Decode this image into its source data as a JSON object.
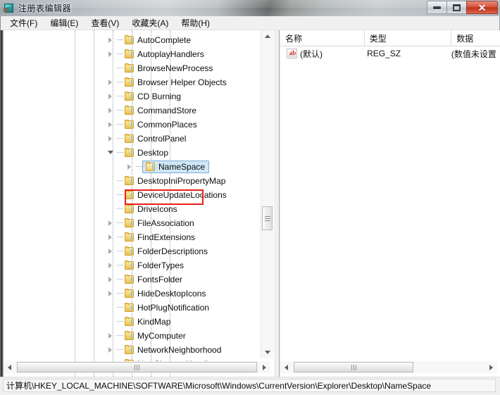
{
  "window": {
    "title": "注册表编辑器",
    "icon": "regedit-icon",
    "buttons": {
      "minimize": "–",
      "maximize": "□",
      "close": "✕"
    }
  },
  "menu": [
    {
      "label": "文件(F)",
      "name": "menu-file"
    },
    {
      "label": "编辑(E)",
      "name": "menu-edit"
    },
    {
      "label": "查看(V)",
      "name": "menu-view"
    },
    {
      "label": "收藏夹(A)",
      "name": "menu-favorites"
    },
    {
      "label": "帮助(H)",
      "name": "menu-help"
    }
  ],
  "tree": {
    "rows": [
      {
        "label": "AutoComplete",
        "twisty": "collapsed",
        "selected": false
      },
      {
        "label": "AutoplayHandlers",
        "twisty": "collapsed",
        "selected": false
      },
      {
        "label": "BrowseNewProcess",
        "twisty": "none",
        "selected": false
      },
      {
        "label": "Browser Helper Objects",
        "twisty": "collapsed",
        "selected": false
      },
      {
        "label": "CD Burning",
        "twisty": "collapsed",
        "selected": false
      },
      {
        "label": "CommandStore",
        "twisty": "collapsed",
        "selected": false
      },
      {
        "label": "CommonPlaces",
        "twisty": "collapsed",
        "selected": false
      },
      {
        "label": "ControlPanel",
        "twisty": "collapsed",
        "selected": false
      },
      {
        "label": "Desktop",
        "twisty": "expanded",
        "selected": false
      },
      {
        "label": "NameSpace",
        "twisty": "collapsed",
        "selected": true,
        "child": true
      },
      {
        "label": "DesktopIniPropertyMap",
        "twisty": "none",
        "selected": false
      },
      {
        "label": "DeviceUpdateLocations",
        "twisty": "none",
        "selected": false
      },
      {
        "label": "DriveIcons",
        "twisty": "none",
        "selected": false
      },
      {
        "label": "FileAssociation",
        "twisty": "collapsed",
        "selected": false
      },
      {
        "label": "FindExtensions",
        "twisty": "collapsed",
        "selected": false
      },
      {
        "label": "FolderDescriptions",
        "twisty": "collapsed",
        "selected": false
      },
      {
        "label": "FolderTypes",
        "twisty": "collapsed",
        "selected": false
      },
      {
        "label": "FontsFolder",
        "twisty": "collapsed",
        "selected": false
      },
      {
        "label": "HideDesktopIcons",
        "twisty": "collapsed",
        "selected": false
      },
      {
        "label": "HotPlugNotification",
        "twisty": "none",
        "selected": false
      },
      {
        "label": "KindMap",
        "twisty": "none",
        "selected": false
      },
      {
        "label": "MyComputer",
        "twisty": "collapsed",
        "selected": false
      },
      {
        "label": "NetworkNeighborhood",
        "twisty": "collapsed",
        "selected": false
      },
      {
        "label": "NewShortcutHandlers",
        "twisty": "none",
        "selected": false
      }
    ]
  },
  "list": {
    "columns": [
      {
        "label": "名称",
        "name": "column-name"
      },
      {
        "label": "类型",
        "name": "column-type"
      },
      {
        "label": "数据",
        "name": "column-data"
      }
    ],
    "rows": [
      {
        "icon": "string-value-icon",
        "icon_text": "ab",
        "name": "(默认)",
        "type": "REG_SZ",
        "data": "(数值未设置"
      }
    ]
  },
  "status": {
    "path": "计算机\\HKEY_LOCAL_MACHINE\\SOFTWARE\\Microsoft\\Windows\\CurrentVersion\\Explorer\\Desktop\\NameSpace"
  },
  "annotation": {
    "target": "NameSpace",
    "color": "#e8201a"
  },
  "colors": {
    "selection_fill": "#cfe7f7",
    "selection_border": "#7aadd4",
    "annotation": "#e8201a",
    "folder": "#f8d772",
    "close_button": "#c0321c"
  }
}
